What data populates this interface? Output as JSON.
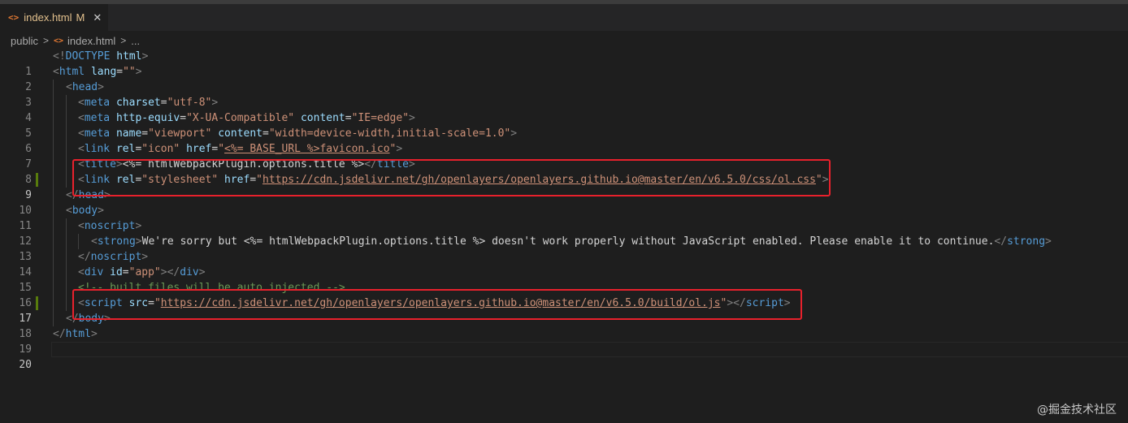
{
  "tab": {
    "icon": "<>",
    "filename": "index.html",
    "status": "M",
    "close_icon": "✕"
  },
  "breadcrumb": {
    "folder": "public",
    "separator": ">",
    "file_icon": "<>",
    "file": "index.html",
    "more": "..."
  },
  "line_numbers": [
    "1",
    "2",
    "3",
    "4",
    "5",
    "6",
    "7",
    "8",
    "9",
    "10",
    "11",
    "12",
    "13",
    "14",
    "15",
    "16",
    "17",
    "18",
    "19",
    "20"
  ],
  "code": {
    "l1": {
      "open": "<!",
      "doctype": "DOCTYPE",
      "space": " ",
      "attr": "html",
      "close": ">"
    },
    "l2": {
      "open": "<",
      "tag": "html",
      "sp": " ",
      "attr": "lang",
      "eq": "=",
      "val": "\"\"",
      "close": ">"
    },
    "l3": {
      "open": "<",
      "tag": "head",
      "close": ">"
    },
    "l4": {
      "open": "<",
      "tag": "meta",
      "sp": " ",
      "attr": "charset",
      "eq": "=",
      "val": "\"utf-8\"",
      "close": ">"
    },
    "l5": {
      "open": "<",
      "tag": "meta",
      "sp": " ",
      "attr1": "http-equiv",
      "eq1": "=",
      "val1": "\"X-UA-Compatible\"",
      "sp2": " ",
      "attr2": "content",
      "eq2": "=",
      "val2": "\"IE=edge\"",
      "close": ">"
    },
    "l6": {
      "open": "<",
      "tag": "meta",
      "sp": " ",
      "attr1": "name",
      "eq1": "=",
      "val1": "\"viewport\"",
      "sp2": " ",
      "attr2": "content",
      "eq2": "=",
      "val2": "\"width=device-width,initial-scale=1.0\"",
      "close": ">"
    },
    "l7": {
      "open": "<",
      "tag": "link",
      "sp": " ",
      "attr1": "rel",
      "eq1": "=",
      "val1": "\"icon\"",
      "sp2": " ",
      "attr2": "href",
      "eq2": "=",
      "q1": "\"",
      "val2": "<%= BASE_URL %>favicon.ico",
      "q2": "\"",
      "close": ">"
    },
    "l8": {
      "open": "<",
      "tag": "title",
      "close": ">",
      "text": "<%= htmlWebpackPlugin.options.title %>",
      "open2": "</",
      "tag2": "title",
      "close2": ">"
    },
    "l9": {
      "open": "<",
      "tag": "link",
      "sp": " ",
      "attr1": "rel",
      "eq1": "=",
      "val1": "\"stylesheet\"",
      "sp2": " ",
      "attr2": "href",
      "eq2": "=",
      "q1": "\"",
      "url": "https://cdn.jsdelivr.net/gh/openlayers/openlayers.github.io@master/en/v6.5.0/css/ol.css",
      "q2": "\"",
      "close": ">"
    },
    "l10": {
      "open": "</",
      "tag": "head",
      "close": ">"
    },
    "l11": {
      "open": "<",
      "tag": "body",
      "close": ">"
    },
    "l12": {
      "open": "<",
      "tag": "noscript",
      "close": ">"
    },
    "l13": {
      "open": "<",
      "tag": "strong",
      "close": ">",
      "text": "We're sorry but <%= htmlWebpackPlugin.options.title %> doesn't work properly without JavaScript enabled. Please enable it to continue.",
      "open2": "</",
      "tag2": "strong",
      "close2": ">"
    },
    "l14": {
      "open": "</",
      "tag": "noscript",
      "close": ">"
    },
    "l15": {
      "open": "<",
      "tag": "div",
      "sp": " ",
      "attr": "id",
      "eq": "=",
      "val": "\"app\"",
      "close": ">",
      "open2": "</",
      "tag2": "div",
      "close2": ">"
    },
    "l16": {
      "comment": "<!-- built files will be auto injected -->"
    },
    "l17": {
      "open": "<",
      "tag": "script",
      "sp": " ",
      "attr": "src",
      "eq": "=",
      "q1": "\"",
      "url": "https://cdn.jsdelivr.net/gh/openlayers/openlayers.github.io@master/en/v6.5.0/build/ol.js",
      "q2": "\"",
      "close": ">",
      "open2": "</",
      "tag2": "script",
      "close2": ">"
    },
    "l18": {
      "open": "</",
      "tag": "body",
      "close": ">"
    },
    "l19": {
      "open": "</",
      "tag": "html",
      "close": ">"
    }
  },
  "watermark": "@掘金技术社区",
  "colors": {
    "tag": "#569cd6",
    "attribute": "#9cdcfe",
    "string": "#ce9178",
    "punctuation": "#808080",
    "text": "#d4d4d4",
    "highlight_box": "#e8212c",
    "modified_gutter": "#587c0c"
  }
}
